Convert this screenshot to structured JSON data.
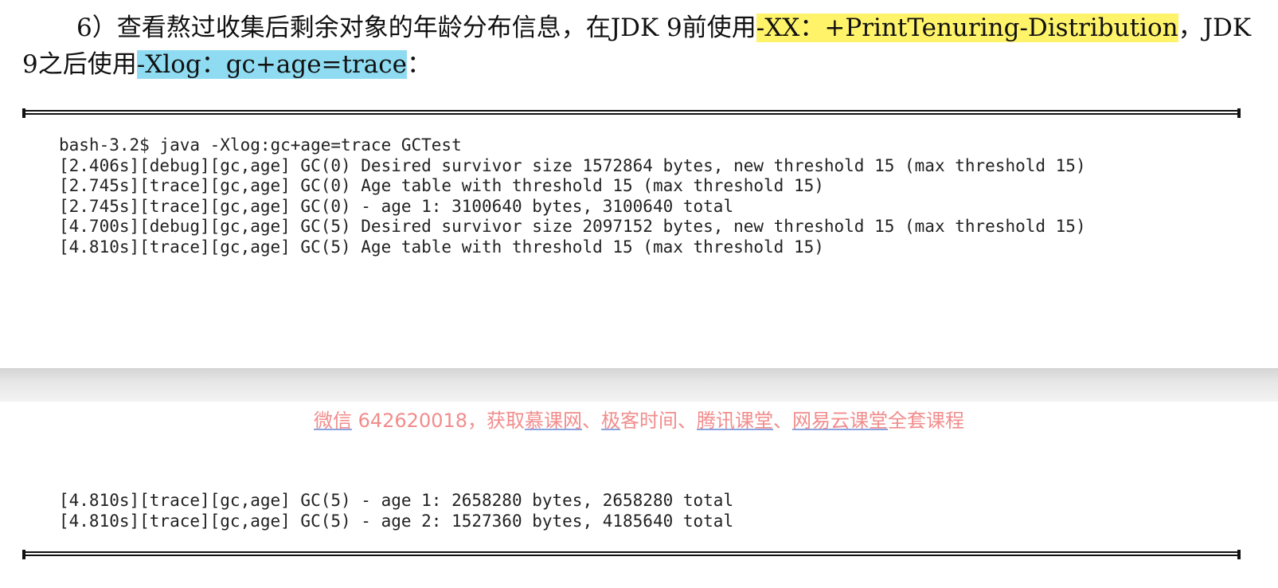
{
  "paragraph": {
    "prefix": "6）查看熬过收集后剩余对象的年龄分布信息，在JDK 9前使用",
    "option_old": "-XX：+PrintTenuring-Distribution",
    "middle": "，JDK 9之后使用",
    "option_new": "-Xlog：gc+age=trace",
    "suffix": "："
  },
  "code_block_1": {
    "lines": [
      "bash-3.2$ java -Xlog:gc+age=trace GCTest",
      "[2.406s][debug][gc,age] GC(0) Desired survivor size 1572864 bytes, new threshold 15 (max threshold 15)",
      "[2.745s][trace][gc,age] GC(0) Age table with threshold 15 (max threshold 15)",
      "[2.745s][trace][gc,age] GC(0) - age 1: 3100640 bytes, 3100640 total",
      "[4.700s][debug][gc,age] GC(5) Desired survivor size 2097152 bytes, new threshold 15 (max threshold 15)",
      "[4.810s][trace][gc,age] GC(5) Age table with threshold 15 (max threshold 15)"
    ]
  },
  "watermark": {
    "p1": "微信",
    "p2": " 642620018，获取",
    "p3": "慕课网",
    "p4": "、",
    "p5": "极",
    "p6": "客时间、",
    "p7": "腾讯课堂",
    "p8": "、",
    "p9": "网易云课堂",
    "p10": "全套课程"
  },
  "code_block_2": {
    "lines": [
      "[4.810s][trace][gc,age] GC(5) - age 1: 2658280 bytes, 2658280 total",
      "[4.810s][trace][gc,age] GC(5) - age 2: 1527360 bytes, 4185640 total"
    ]
  }
}
